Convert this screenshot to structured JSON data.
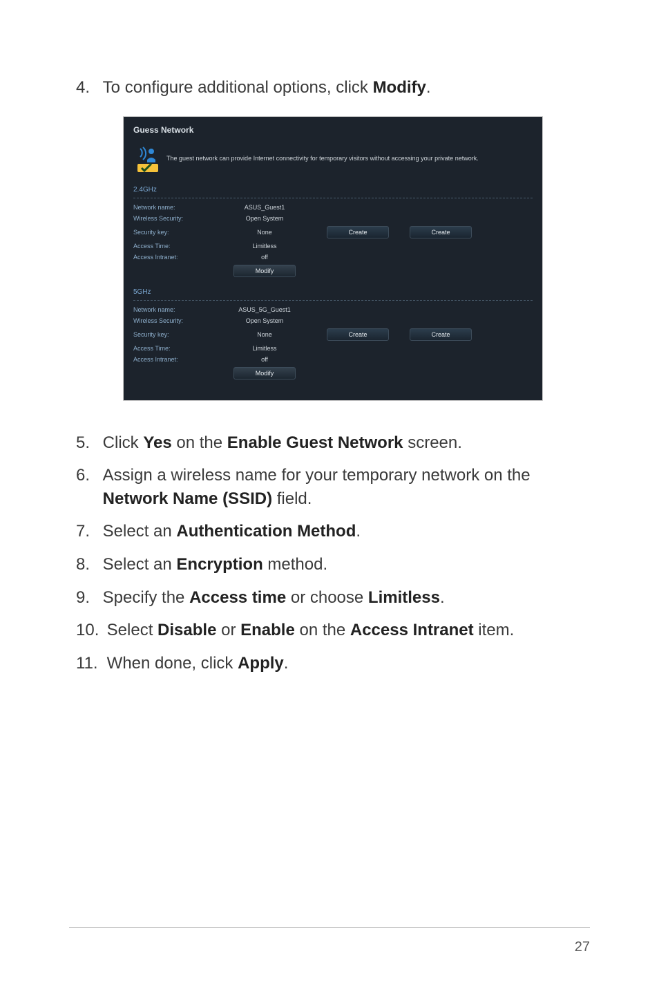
{
  "steps": {
    "s4": {
      "num": "4.",
      "pre": "To configure additional options, click ",
      "b1": "Modify",
      "post": "."
    },
    "s5": {
      "num": "5.",
      "pre": "Click ",
      "b1": "Yes",
      "mid": " on the ",
      "b2": "Enable Guest Network",
      "post": " screen."
    },
    "s6": {
      "num": "6.",
      "pre": "Assign a wireless name for your temporary network on the ",
      "b1": "Network Name (SSID)",
      "post": " field."
    },
    "s7": {
      "num": "7.",
      "pre": "Select an ",
      "b1": "Authentication Method",
      "post": "."
    },
    "s8": {
      "num": "8.",
      "pre": "Select an ",
      "b1": "Encryption",
      "post": " method."
    },
    "s9": {
      "num": "9.",
      "pre": "Specify the ",
      "b1": "Access time",
      "mid": " or choose ",
      "b2": "Limitless",
      "post": "."
    },
    "s10": {
      "num": "10.",
      "pre": "Select ",
      "b1": "Disable",
      "mid1": " or ",
      "b2": "Enable",
      "mid2": " on the ",
      "b3": "Access Intranet",
      "post": " item."
    },
    "s11": {
      "num": "11.",
      "pre": "When done, click ",
      "b1": "Apply",
      "post": "."
    }
  },
  "panel": {
    "title": "Guess Network",
    "desc": "The guest network can provide Internet connectivity for temporary visitors without accessing your private network.",
    "band24": {
      "title": "2.4GHz",
      "rows": {
        "network_name": {
          "label": "Network name:",
          "value": "ASUS_Guest1"
        },
        "wireless_security": {
          "label": "Wireless Security:",
          "value": "Open System"
        },
        "security_key": {
          "label": "Security key:",
          "value": "None"
        },
        "access_time": {
          "label": "Access Time:",
          "value": "Limitless"
        },
        "access_intranet": {
          "label": "Access Intranet:",
          "value": "off"
        }
      },
      "create1": "Create",
      "create2": "Create",
      "modify": "Modify"
    },
    "band5": {
      "title": "5GHz",
      "rows": {
        "network_name": {
          "label": "Network name:",
          "value": "ASUS_5G_Guest1"
        },
        "wireless_security": {
          "label": "Wireless Security:",
          "value": "Open System"
        },
        "security_key": {
          "label": "Security key:",
          "value": "None"
        },
        "access_time": {
          "label": "Access Time:",
          "value": "Limitless"
        },
        "access_intranet": {
          "label": "Access Intranet:",
          "value": "off"
        }
      },
      "create1": "Create",
      "create2": "Create",
      "modify": "Modify"
    }
  },
  "page_number": "27"
}
